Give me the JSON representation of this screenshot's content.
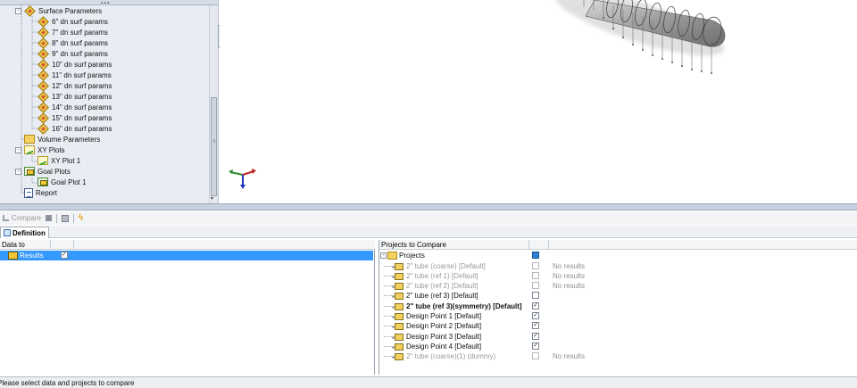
{
  "tree": {
    "items": [
      {
        "label": "Surface Parameters",
        "icon": "diamond-icon",
        "level": 1,
        "expander": "-"
      },
      {
        "label": "6\" dn surf params",
        "icon": "diamond-icon",
        "level": 2
      },
      {
        "label": "7\" dn surf params",
        "icon": "diamond-icon",
        "level": 2
      },
      {
        "label": "8\" dn surf params",
        "icon": "diamond-icon",
        "level": 2
      },
      {
        "label": "9\" dn surf params",
        "icon": "diamond-icon",
        "level": 2
      },
      {
        "label": "10\" dn surf params",
        "icon": "diamond-icon",
        "level": 2
      },
      {
        "label": "11\" dn surf params",
        "icon": "diamond-icon",
        "level": 2
      },
      {
        "label": "12\" dn surf params",
        "icon": "diamond-icon",
        "level": 2
      },
      {
        "label": "13\" dn surf params",
        "icon": "diamond-icon",
        "level": 2
      },
      {
        "label": "14\" dn surf params",
        "icon": "diamond-icon",
        "level": 2
      },
      {
        "label": "15\" dn surf params",
        "icon": "diamond-icon",
        "level": 2
      },
      {
        "label": "16\" dn surf params",
        "icon": "diamond-icon",
        "level": 2
      },
      {
        "label": "Volume Parameters",
        "icon": "folder-icon",
        "level": 1
      },
      {
        "label": "XY Plots",
        "icon": "xy-plot-icon",
        "level": 1,
        "expander": "-"
      },
      {
        "label": "XY Plot 1",
        "icon": "xy-plot-icon",
        "level": 2
      },
      {
        "label": "Goal Plots",
        "icon": "goal-plot-icon",
        "level": 1,
        "expander": "-"
      },
      {
        "label": "Goal Plot 1",
        "icon": "goal-plot-icon",
        "level": 2
      },
      {
        "label": "Report",
        "icon": "report-icon",
        "level": 1
      }
    ]
  },
  "toolbar": {
    "compare_label": "Compare"
  },
  "tabs": {
    "definition_label": "Definition"
  },
  "data_to_compare": {
    "header_name": "Data to Compare",
    "header_check": "",
    "row": {
      "label": "Results",
      "checked": "✓"
    }
  },
  "projects_to_compare": {
    "header_name": "Projects to Compare",
    "root_label": "Projects",
    "root_expander": "-",
    "projects": [
      {
        "label": "2\" tube (coarse) [Default]",
        "checked": "",
        "status": "No results",
        "dim": true,
        "bold": false
      },
      {
        "label": "2\" tube (ref 1) [Default]",
        "checked": "",
        "status": "No results",
        "dim": true,
        "bold": false
      },
      {
        "label": "2\" tube (ref 2) [Default]",
        "checked": "",
        "status": "No results",
        "dim": true,
        "bold": false
      },
      {
        "label": "2\" tube (ref 3) [Default]",
        "checked": "",
        "status": "",
        "dim": false,
        "bold": false
      },
      {
        "label": "2\" tube (ref 3)(symmetry) [Default]",
        "checked": "✓",
        "status": "",
        "dim": false,
        "bold": true
      },
      {
        "label": "Design Point 1 [Default]",
        "checked": "✓",
        "status": "",
        "dim": false,
        "bold": false
      },
      {
        "label": "Design Point 2 [Default]",
        "checked": "✓",
        "status": "",
        "dim": false,
        "bold": false
      },
      {
        "label": "Design Point 3 [Default]",
        "checked": "✓",
        "status": "",
        "dim": false,
        "bold": false
      },
      {
        "label": "Design Point 4 [Default]",
        "checked": "✓",
        "status": "",
        "dim": false,
        "bold": false
      },
      {
        "label": "2\" tube (coarse)(1) (dummy)",
        "checked": "",
        "status": "No results",
        "dim": true,
        "bold": false
      }
    ]
  },
  "status_bar": {
    "text": "Please select data and projects to compare"
  },
  "colors": {
    "selection": "#3399ff",
    "panel_bg": "#e9edf3",
    "accent_checked": "#2f7fd1"
  }
}
